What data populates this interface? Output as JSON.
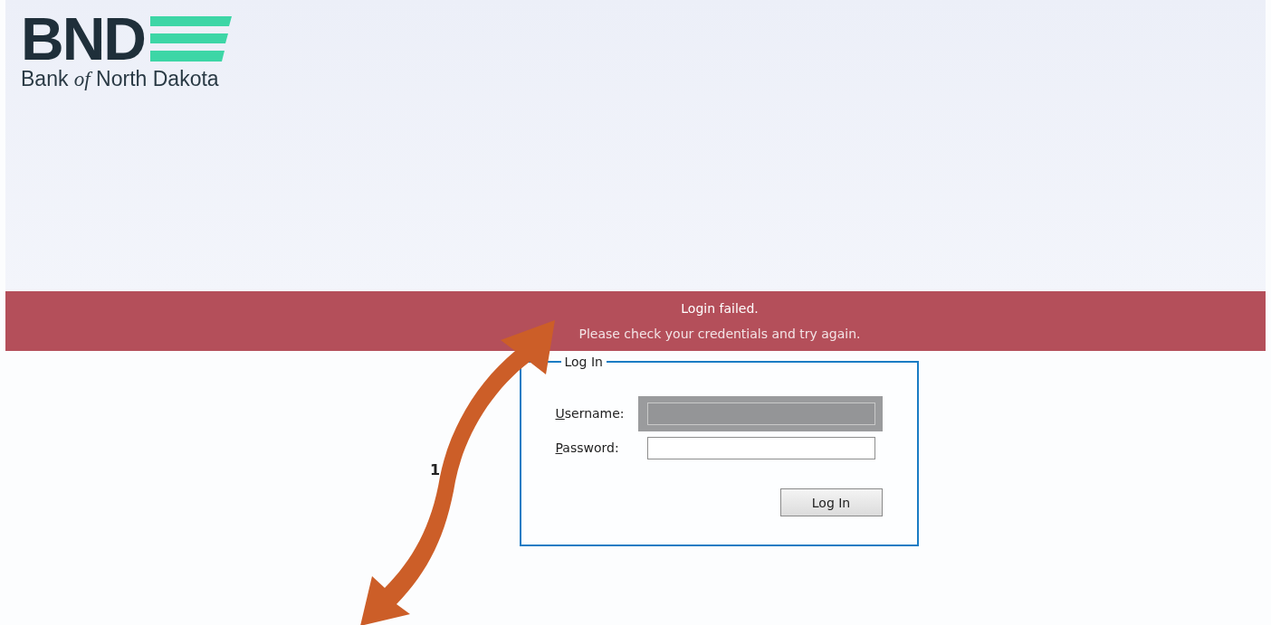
{
  "logo": {
    "mark": "BND",
    "name": "Bank",
    "name_italic": "of",
    "name_rest": "North Dakota"
  },
  "alert": {
    "title": "Login failed.",
    "message": "Please check your credentials and try again."
  },
  "login": {
    "legend": "Log In",
    "fields": [
      {
        "label": "Username:",
        "access_key_shown": true,
        "focused": true
      },
      {
        "label": "Password:",
        "access_key_shown": true,
        "focused": false
      }
    ],
    "button": "Log In"
  },
  "annotation": {
    "label": "1"
  }
}
